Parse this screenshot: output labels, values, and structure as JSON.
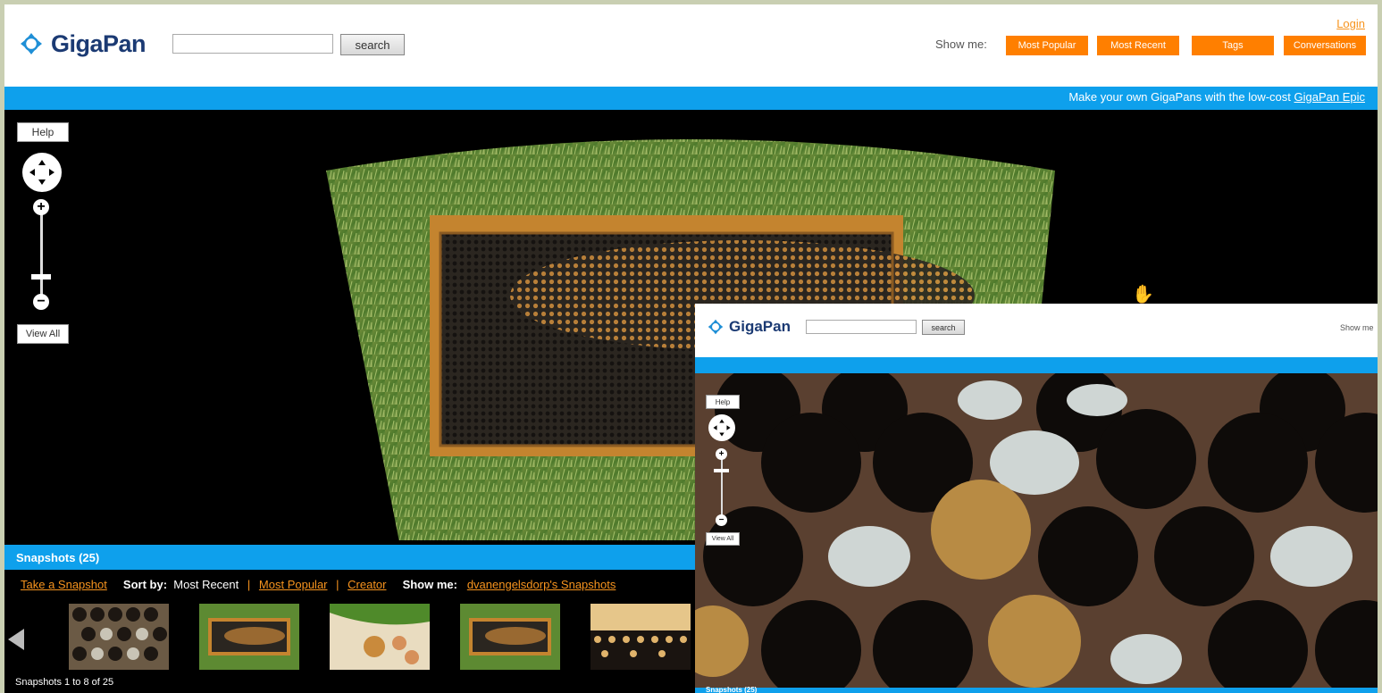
{
  "header": {
    "logo_text": "GigaPan",
    "search_button": "search",
    "login": "Login",
    "show_me_label": "Show me:",
    "show_me_buttons": [
      "Most Popular",
      "Most Recent",
      "Tags",
      "Conversations"
    ]
  },
  "promo": {
    "text": "Make your own GigaPans with the low-cost ",
    "link": "GigaPan Epic"
  },
  "viewer": {
    "help": "Help",
    "view_all": "View All",
    "zoom_in": "+",
    "zoom_out": "−"
  },
  "snapshots": {
    "title": "Snapshots (25)",
    "take_snapshot": "Take a Snapshot",
    "sort_by_label": "Sort by:",
    "sort_current": "Most Recent",
    "sort_popular": "Most Popular",
    "sort_creator": "Creator",
    "show_me_label": "Show me:",
    "show_me_link": "dvanengelsdorp's Snapshots",
    "sep": "|",
    "count": "Snapshots 1 to 8 of 25"
  },
  "inset": {
    "logo_text": "GigaPan",
    "search_button": "search",
    "show_me_label": "Show me",
    "help": "Help",
    "view_all": "View All",
    "zoom_in": "+",
    "zoom_out": "−",
    "snapshots_title": "Snapshots (25)"
  },
  "colors": {
    "accent_orange": "#ff7f00",
    "bar_blue": "#0ea0ec",
    "logo_navy": "#1b3a73"
  }
}
